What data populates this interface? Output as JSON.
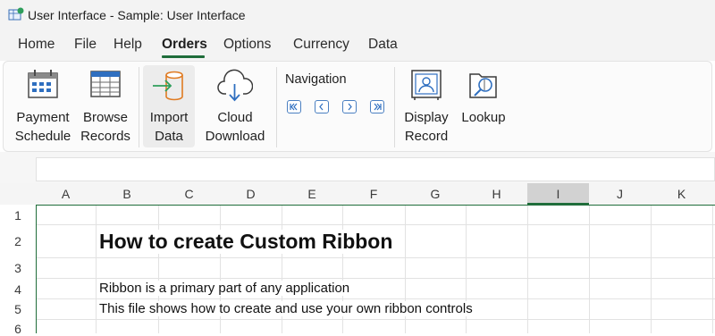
{
  "window": {
    "title": "User Interface - Sample: User Interface",
    "app_icon": "sheet-app-icon"
  },
  "menu": {
    "tabs": [
      "Home",
      "File",
      "Help",
      "Orders",
      "Options",
      "Currency",
      "Data"
    ],
    "active": "Orders",
    "accent_color": "#1f6d3a"
  },
  "ribbon": {
    "payment_schedule": {
      "line1": "Payment",
      "line2": "Schedule",
      "icon": "calendar-icon"
    },
    "browse_records": {
      "line1": "Browse",
      "line2": "Records",
      "icon": "table-icon"
    },
    "import_data": {
      "line1": "Import",
      "line2": "Data",
      "icon": "database-import-icon"
    },
    "cloud_download": {
      "line1": "Cloud",
      "line2": "Download",
      "icon": "cloud-download-icon"
    },
    "navigation": {
      "title": "Navigation",
      "buttons": [
        "first-icon",
        "previous-icon",
        "next-icon",
        "last-icon"
      ]
    },
    "display_record": {
      "line1": "Display",
      "line2": "Record",
      "icon": "contact-card-icon"
    },
    "lookup": {
      "line1": "Lookup",
      "icon": "folder-search-icon"
    }
  },
  "sheet": {
    "columns": [
      "A",
      "B",
      "C",
      "D",
      "E",
      "F",
      "G",
      "H",
      "I",
      "J",
      "K"
    ],
    "selected_column": "I",
    "rows": [
      "1",
      "2",
      "3",
      "4",
      "5",
      "6"
    ],
    "cells": {
      "B2": "How to create Custom Ribbon",
      "B4": "Ribbon is a primary part of any application",
      "B5": "This file shows how to create and use your own ribbon controls"
    }
  }
}
